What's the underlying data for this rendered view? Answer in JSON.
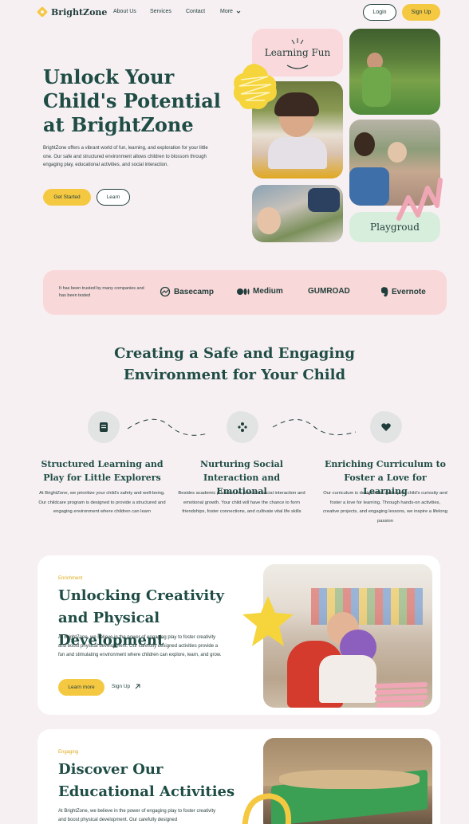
{
  "nav": {
    "brand": "BrightZone",
    "links": [
      "About Us",
      "Services",
      "Contact",
      "More"
    ],
    "login": "Login",
    "signup": "Sign Up"
  },
  "hero": {
    "title": "Unlock Your Child's Potential at BrightZone",
    "description": "BrightZone offers a vibrant world of fun, learning, and exploration for your little one. Our safe and structured environment allows children to blossom through engaging play, educational activities, and social interaction.",
    "cta_primary": "Get Started",
    "cta_secondary": "Learn",
    "tile_learning": "Learning Fun",
    "tile_playground": "Playgroud"
  },
  "trust": {
    "text": "It has been trusted by many companies and has been tested",
    "brands": [
      "Basecamp",
      "Medium",
      "GUMROAD",
      "Evernote"
    ]
  },
  "features": {
    "title": "Creating a Safe and Engaging Environment for Your Child",
    "items": [
      {
        "icon": "book-icon",
        "title": "Structured Learning and Play for Little Explorers",
        "desc": "At BrightZone, we prioritize your child's safety and well-being. Our childcare program is designed to provide a structured and engaging environment where children can learn"
      },
      {
        "icon": "people-icon",
        "title": "Nurturing Social Interaction and Emotional",
        "desc": "Besides academic pursuits, we prioritize social interaction and emotional growth. Your child will have the chance to form friendships, foster connections, and cultivate vital life skills"
      },
      {
        "icon": "heart-icon",
        "title": "Enriching Curriculum to Foster a Love for Learning",
        "desc": "Our curriculum is designed to ignite your child's curiosity and foster a love for learning. Through hands-on activities, creative projects, and engaging lessons, we inspire a lifelong passion"
      }
    ]
  },
  "card1": {
    "eyebrow": "Enrichment",
    "title": "Unlocking Creativity and Physical Development",
    "desc": "At BrightZone, we believe in the power of engaging play to foster creativity and boost physical development. Our carefully designed activities provide a fun and stimulating environment where children can explore, learn, and grow.",
    "cta": "Learn more",
    "link": "Sign Up"
  },
  "card2": {
    "eyebrow": "Engaging",
    "title": "Discover Our Educational Activities",
    "desc": "At BrightZone, we believe in the power of engaging play to foster creativity and boost physical development. Our carefully designed"
  },
  "colors": {
    "accent": "#f5c842",
    "primary": "#1f4d45",
    "background": "#f7f0f3",
    "pink": "#f9d8d9",
    "mint": "#d8eedd"
  }
}
